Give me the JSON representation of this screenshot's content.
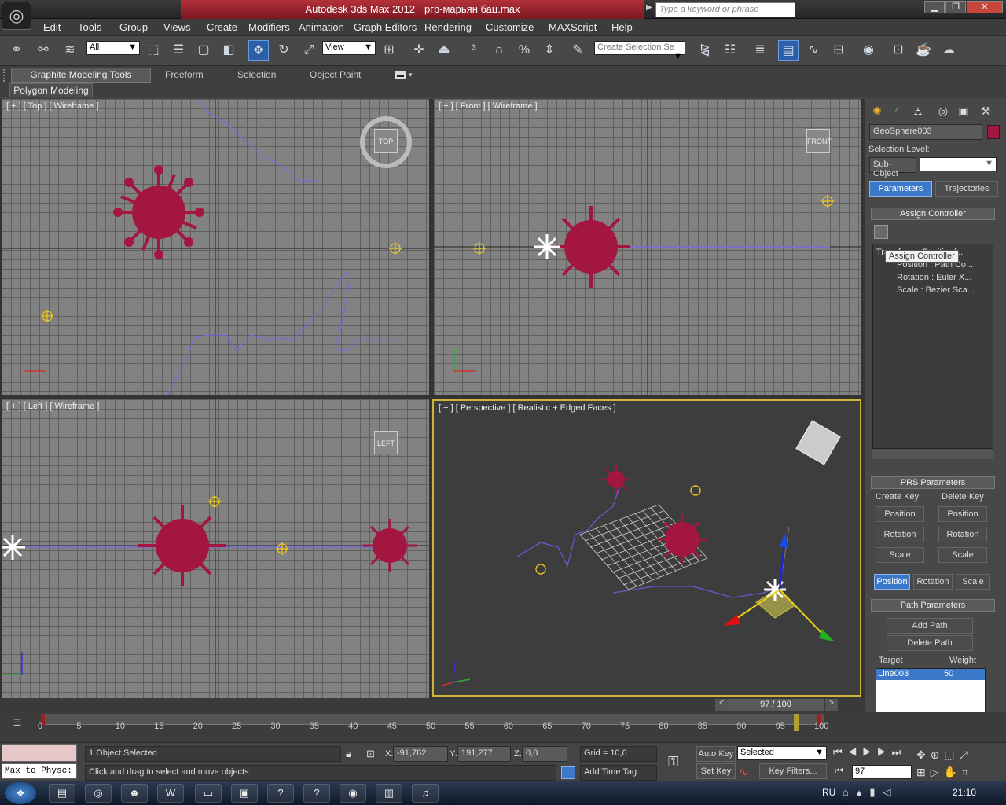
{
  "title": {
    "app": "Autodesk 3ds Max  2012",
    "file": "ргр-марьян бац.max"
  },
  "search": {
    "placeholder": "Type a keyword or phrase"
  },
  "menu": [
    "Edit",
    "Tools",
    "Group",
    "Views",
    "Create",
    "Modifiers",
    "Animation",
    "Graph Editors",
    "Rendering",
    "Customize",
    "MAXScript",
    "Help"
  ],
  "toolbar": {
    "filter": "All",
    "refcoord": "View",
    "selection_set": "Create Selection Se"
  },
  "ribbon": {
    "tabs": [
      "Graphite Modeling Tools",
      "Freeform",
      "Selection",
      "Object Paint"
    ],
    "panel": "Polygon Modeling"
  },
  "viewports": {
    "top": "[ + ] [ Top ] [ Wireframe ]",
    "front": "[ + ] [ Front ] [ Wireframe ]",
    "left": "[ + ] [ Left ] [ Wireframe ]",
    "persp": "[ + ] [ Perspective ] [ Realistic + Edged Faces ]",
    "cube_top": "TOP",
    "cube_front": "FRONT",
    "cube_left": "LEFT"
  },
  "cmd": {
    "object_name": "GeoSphere003",
    "selection_level": "Selection Level:",
    "sub_object": "Sub-Object",
    "tab_parameters": "Parameters",
    "tab_trajectories": "Trajectories",
    "assign_controller": "Assign Controller",
    "tooltip": "Assign Controller",
    "tree": [
      "Transform : Position/...",
      "Position : Path Co...",
      "Rotation : Euler X...",
      "Scale : Bezier Sca..."
    ],
    "prs": "PRS Parameters",
    "create_key": "Create Key",
    "delete_key": "Delete Key",
    "position": "Position",
    "rotation": "Rotation",
    "scale": "Scale",
    "path_params": "Path Parameters",
    "add_path": "Add Path",
    "delete_path": "Delete Path",
    "target": "Target",
    "weight": "Weight",
    "target_name": "Line003",
    "target_weight": "50"
  },
  "timeline": {
    "frame": "97 / 100",
    "ticks": [
      "0",
      "5",
      "10",
      "15",
      "20",
      "25",
      "30",
      "35",
      "40",
      "45",
      "50",
      "55",
      "60",
      "65",
      "70",
      "75",
      "80",
      "85",
      "90",
      "95",
      "100"
    ]
  },
  "status": {
    "selected": "1 Object Selected",
    "prompt": "Click and drag to select and move objects",
    "maxscript": "Max to Physc:",
    "x": "-91,762",
    "y": "191,277",
    "z": "0,0",
    "grid": "Grid = 10,0",
    "add_time_tag": "Add Time Tag",
    "auto_key": "Auto Key",
    "set_key": "Set Key",
    "key_mode": "Selected",
    "key_filters": "Key Filters...",
    "frame": "97",
    "coord_x": "X:",
    "coord_y": "Y:",
    "coord_z": "Z:"
  },
  "taskbar": {
    "lang": "RU",
    "clock": "21:10"
  },
  "colors": {
    "accent": "#2b5fa8",
    "virus": "#a3163f",
    "persp_border": "#d4b23a",
    "path": "#7b6ad8"
  }
}
